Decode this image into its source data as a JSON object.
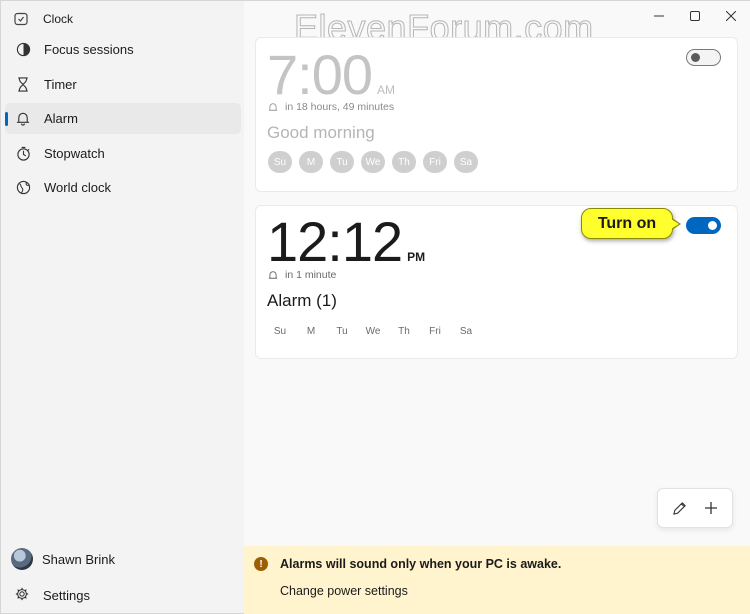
{
  "app": {
    "title": "Clock",
    "watermark": "ElevenForum.com"
  },
  "sidebar": {
    "items": [
      {
        "label": "Focus sessions",
        "icon": "focus-icon",
        "active": false
      },
      {
        "label": "Timer",
        "icon": "hourglass-icon",
        "active": false
      },
      {
        "label": "Alarm",
        "icon": "bell-icon",
        "active": true
      },
      {
        "label": "Stopwatch",
        "icon": "stopwatch-icon",
        "active": false
      },
      {
        "label": "World clock",
        "icon": "globe-icon",
        "active": false
      }
    ],
    "user_name": "Shawn Brink",
    "settings_label": "Settings"
  },
  "alarms": [
    {
      "time": "7:00",
      "ampm": "AM",
      "remaining": "in 18 hours, 49 minutes",
      "name": "Good morning",
      "days": [
        "Su",
        "M",
        "Tu",
        "We",
        "Th",
        "Fri",
        "Sa"
      ],
      "enabled": false
    },
    {
      "time": "12:12",
      "ampm": "PM",
      "remaining": "in 1 minute",
      "name": "Alarm (1)",
      "days": [
        "Su",
        "M",
        "Tu",
        "We",
        "Th",
        "Fri",
        "Sa"
      ],
      "enabled": true
    }
  ],
  "callout": {
    "text": "Turn on"
  },
  "banner": {
    "message": "Alarms will sound only when your PC is awake.",
    "link": "Change power settings"
  },
  "colors": {
    "accent": "#0067c0",
    "banner_bg": "#fff4ce",
    "callout_bg": "#ffff2e"
  }
}
